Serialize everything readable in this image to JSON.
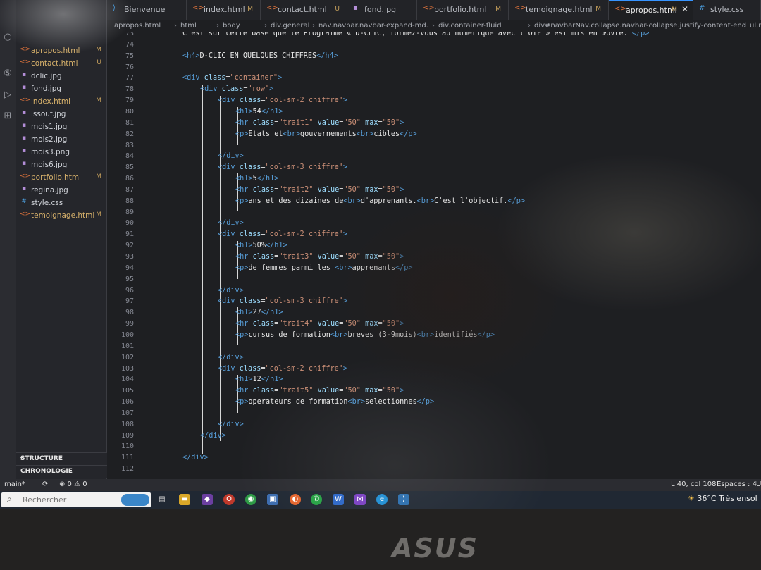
{
  "tabs": [
    {
      "label": "Bienvenue",
      "icon": "vscode-icon",
      "mod": ""
    },
    {
      "label": "index.html",
      "icon": "html-icon",
      "mod": "M"
    },
    {
      "label": "contact.html",
      "icon": "html-icon",
      "mod": "U"
    },
    {
      "label": "fond.jpg",
      "icon": "image-icon",
      "mod": ""
    },
    {
      "label": "portfolio.html",
      "icon": "html-icon",
      "mod": "M"
    },
    {
      "label": "temoignage.html",
      "icon": "html-icon",
      "mod": "M"
    },
    {
      "label": "apropos.html",
      "icon": "html-icon",
      "mod": "M"
    },
    {
      "label": "style.css",
      "icon": "css-icon",
      "mod": ""
    }
  ],
  "breadcrumbs": [
    "apropos.html",
    "html",
    "body",
    "div.general",
    "nav.navbar.navbar-expand-md.",
    "div.container-fluid",
    "div#navbarNav.collapse.navbar-collapse.justify-content-end",
    "ul.n"
  ],
  "explorer": {
    "files": [
      {
        "name": "apropos.html",
        "type": "html",
        "mod": "M"
      },
      {
        "name": "contact.html",
        "type": "html",
        "mod": "U"
      },
      {
        "name": "dclic.jpg",
        "type": "img",
        "mod": ""
      },
      {
        "name": "fond.jpg",
        "type": "img",
        "mod": ""
      },
      {
        "name": "index.html",
        "type": "html",
        "mod": "M"
      },
      {
        "name": "issouf.jpg",
        "type": "img",
        "mod": ""
      },
      {
        "name": "mois1.jpg",
        "type": "img",
        "mod": ""
      },
      {
        "name": "mois2.jpg",
        "type": "img",
        "mod": ""
      },
      {
        "name": "mois3.png",
        "type": "img",
        "mod": ""
      },
      {
        "name": "mois6.jpg",
        "type": "img",
        "mod": ""
      },
      {
        "name": "portfolio.html",
        "type": "html",
        "mod": "M"
      },
      {
        "name": "regina.jpg",
        "type": "img",
        "mod": ""
      },
      {
        "name": "style.css",
        "type": "css",
        "mod": ""
      },
      {
        "name": "temoignage.html",
        "type": "html",
        "mod": "M"
      }
    ],
    "sections": [
      "STRUCTURE",
      "CHRONOLOGIE"
    ]
  },
  "code_lines": [
    {
      "n": "73",
      "indent": 0,
      "parts": [
        [
          "txt",
          "C'est sur cette base que le Programme « D-CLIC, formez-vous au numérique avec l'OIF » est mis en œuvre. "
        ],
        [
          "tag",
          "</p>"
        ]
      ]
    },
    {
      "n": "74",
      "indent": 0,
      "parts": []
    },
    {
      "n": "75",
      "indent": 0,
      "parts": [
        [
          "tag",
          "<h4>"
        ],
        [
          "txt",
          "D-CLIC EN QUELQUES CHIFFRES"
        ],
        [
          "tag",
          "</h4>"
        ]
      ]
    },
    {
      "n": "76",
      "indent": 0,
      "parts": []
    },
    {
      "n": "77",
      "indent": 0,
      "parts": [
        [
          "tag",
          "<div "
        ],
        [
          "attr",
          "class"
        ],
        [
          "txt",
          "="
        ],
        [
          "str",
          "\"container\""
        ],
        [
          "tag",
          ">"
        ]
      ]
    },
    {
      "n": "78",
      "indent": 1,
      "parts": [
        [
          "tag",
          "<div "
        ],
        [
          "attr",
          "class"
        ],
        [
          "txt",
          "="
        ],
        [
          "str",
          "\"row\""
        ],
        [
          "tag",
          ">"
        ]
      ]
    },
    {
      "n": "79",
      "indent": 2,
      "parts": [
        [
          "tag",
          "<div "
        ],
        [
          "attr",
          "class"
        ],
        [
          "txt",
          "="
        ],
        [
          "str",
          "\"col-sm-2 chiffre\""
        ],
        [
          "tag",
          ">"
        ]
      ]
    },
    {
      "n": "80",
      "indent": 3,
      "parts": [
        [
          "tag",
          "<h1>"
        ],
        [
          "txt",
          "54"
        ],
        [
          "tag",
          "</h1>"
        ]
      ]
    },
    {
      "n": "81",
      "indent": 3,
      "parts": [
        [
          "tag",
          "<hr "
        ],
        [
          "attr",
          "class"
        ],
        [
          "txt",
          "="
        ],
        [
          "str",
          "\"trait1\""
        ],
        [
          "attr",
          " value"
        ],
        [
          "txt",
          "="
        ],
        [
          "str",
          "\"50\""
        ],
        [
          "attr",
          " max"
        ],
        [
          "txt",
          "="
        ],
        [
          "str",
          "\"50\""
        ],
        [
          "tag",
          ">"
        ]
      ]
    },
    {
      "n": "82",
      "indent": 3,
      "parts": [
        [
          "tag",
          "<p>"
        ],
        [
          "txt",
          "Etats et"
        ],
        [
          "tag",
          "<br>"
        ],
        [
          "txt",
          "gouvernements"
        ],
        [
          "tag",
          "<br>"
        ],
        [
          "txt",
          "cibles"
        ],
        [
          "tag",
          "</p>"
        ]
      ]
    },
    {
      "n": "83",
      "indent": 0,
      "parts": []
    },
    {
      "n": "84",
      "indent": 2,
      "parts": [
        [
          "tag",
          "</div>"
        ]
      ]
    },
    {
      "n": "85",
      "indent": 2,
      "parts": [
        [
          "tag",
          "<div "
        ],
        [
          "attr",
          "class"
        ],
        [
          "txt",
          "="
        ],
        [
          "str",
          "\"col-sm-3 chiffre\""
        ],
        [
          "tag",
          ">"
        ]
      ]
    },
    {
      "n": "86",
      "indent": 3,
      "parts": [
        [
          "tag",
          "<h1>"
        ],
        [
          "txt",
          "5"
        ],
        [
          "tag",
          "</h1>"
        ]
      ]
    },
    {
      "n": "87",
      "indent": 3,
      "parts": [
        [
          "tag",
          "<hr "
        ],
        [
          "attr",
          "class"
        ],
        [
          "txt",
          "="
        ],
        [
          "str",
          "\"trait2\""
        ],
        [
          "attr",
          " value"
        ],
        [
          "txt",
          "="
        ],
        [
          "str",
          "\"50\""
        ],
        [
          "attr",
          " max"
        ],
        [
          "txt",
          "="
        ],
        [
          "str",
          "\"50\""
        ],
        [
          "tag",
          ">"
        ]
      ]
    },
    {
      "n": "88",
      "indent": 3,
      "parts": [
        [
          "tag",
          "<p>"
        ],
        [
          "txt",
          "ans et des dizaines de"
        ],
        [
          "tag",
          "<br>"
        ],
        [
          "txt",
          "d'apprenants."
        ],
        [
          "tag",
          "<br>"
        ],
        [
          "txt",
          "C'est l'objectif."
        ],
        [
          "tag",
          "</p>"
        ]
      ]
    },
    {
      "n": "89",
      "indent": 0,
      "parts": []
    },
    {
      "n": "90",
      "indent": 2,
      "parts": [
        [
          "tag",
          "</div>"
        ]
      ]
    },
    {
      "n": "91",
      "indent": 2,
      "parts": [
        [
          "tag",
          "<div "
        ],
        [
          "attr",
          "class"
        ],
        [
          "txt",
          "="
        ],
        [
          "str",
          "\"col-sm-2 chiffre\""
        ],
        [
          "tag",
          ">"
        ]
      ]
    },
    {
      "n": "92",
      "indent": 3,
      "parts": [
        [
          "tag",
          "<h1>"
        ],
        [
          "txt",
          "50%"
        ],
        [
          "tag",
          "</h1>"
        ]
      ]
    },
    {
      "n": "93",
      "indent": 3,
      "parts": [
        [
          "tag",
          "<hr "
        ],
        [
          "attr",
          "class"
        ],
        [
          "txt",
          "="
        ],
        [
          "str",
          "\"trait3\""
        ],
        [
          "attr",
          " value"
        ],
        [
          "txt",
          "="
        ],
        [
          "str",
          "\"50\""
        ],
        [
          "attr",
          " max"
        ],
        [
          "txt",
          "="
        ],
        [
          "str",
          "\"50\""
        ],
        [
          "tag",
          ">"
        ]
      ]
    },
    {
      "n": "94",
      "indent": 3,
      "parts": [
        [
          "tag",
          "<p>"
        ],
        [
          "txt",
          "de femmes parmi les "
        ],
        [
          "tag",
          "<br>"
        ],
        [
          "txt",
          "apprenants"
        ],
        [
          "tag",
          "</p>"
        ]
      ]
    },
    {
      "n": "95",
      "indent": 0,
      "parts": []
    },
    {
      "n": "96",
      "indent": 2,
      "parts": [
        [
          "tag",
          "</div>"
        ]
      ]
    },
    {
      "n": "97",
      "indent": 2,
      "parts": [
        [
          "tag",
          "<div "
        ],
        [
          "attr",
          "class"
        ],
        [
          "txt",
          "="
        ],
        [
          "str",
          "\"col-sm-3 chiffre\""
        ],
        [
          "tag",
          ">"
        ]
      ]
    },
    {
      "n": "98",
      "indent": 3,
      "parts": [
        [
          "tag",
          "<h1>"
        ],
        [
          "txt",
          "27"
        ],
        [
          "tag",
          "</h1>"
        ]
      ]
    },
    {
      "n": "99",
      "indent": 3,
      "parts": [
        [
          "tag",
          "<hr "
        ],
        [
          "attr",
          "class"
        ],
        [
          "txt",
          "="
        ],
        [
          "str",
          "\"trait4\""
        ],
        [
          "attr",
          " value"
        ],
        [
          "txt",
          "="
        ],
        [
          "str",
          "\"50\""
        ],
        [
          "attr",
          " max"
        ],
        [
          "txt",
          "="
        ],
        [
          "str",
          "\"50\""
        ],
        [
          "tag",
          ">"
        ]
      ]
    },
    {
      "n": "100",
      "indent": 3,
      "parts": [
        [
          "tag",
          "<p>"
        ],
        [
          "txt",
          "cursus de formation"
        ],
        [
          "tag",
          "<br>"
        ],
        [
          "txt",
          "breves (3-9mois)"
        ],
        [
          "tag",
          "<br>"
        ],
        [
          "txt",
          "identifiés"
        ],
        [
          "tag",
          "</p>"
        ]
      ]
    },
    {
      "n": "101",
      "indent": 0,
      "parts": []
    },
    {
      "n": "102",
      "indent": 2,
      "parts": [
        [
          "tag",
          "</div>"
        ]
      ]
    },
    {
      "n": "103",
      "indent": 2,
      "parts": [
        [
          "tag",
          "<div "
        ],
        [
          "attr",
          "class"
        ],
        [
          "txt",
          "="
        ],
        [
          "str",
          "\"col-sm-2 chiffre\""
        ],
        [
          "tag",
          ">"
        ]
      ]
    },
    {
      "n": "104",
      "indent": 3,
      "parts": [
        [
          "tag",
          "<h1>"
        ],
        [
          "txt",
          "12"
        ],
        [
          "tag",
          "</h1>"
        ]
      ]
    },
    {
      "n": "105",
      "indent": 3,
      "parts": [
        [
          "tag",
          "<hr "
        ],
        [
          "attr",
          "class"
        ],
        [
          "txt",
          "="
        ],
        [
          "str",
          "\"trait5\""
        ],
        [
          "attr",
          " value"
        ],
        [
          "txt",
          "="
        ],
        [
          "str",
          "\"50\""
        ],
        [
          "attr",
          " max"
        ],
        [
          "txt",
          "="
        ],
        [
          "str",
          "\"50\""
        ],
        [
          "tag",
          ">"
        ]
      ]
    },
    {
      "n": "106",
      "indent": 3,
      "parts": [
        [
          "tag",
          "<p>"
        ],
        [
          "txt",
          "operateurs de formation"
        ],
        [
          "tag",
          "<br>"
        ],
        [
          "txt",
          "selectionnes"
        ],
        [
          "tag",
          "</p>"
        ]
      ]
    },
    {
      "n": "107",
      "indent": 0,
      "parts": []
    },
    {
      "n": "108",
      "indent": 2,
      "parts": [
        [
          "tag",
          "</div>"
        ]
      ]
    },
    {
      "n": "109",
      "indent": 1,
      "parts": [
        [
          "tag",
          "</div>"
        ]
      ]
    },
    {
      "n": "110",
      "indent": 0,
      "parts": []
    },
    {
      "n": "111",
      "indent": 0,
      "parts": [
        [
          "tag",
          "</div>"
        ]
      ]
    },
    {
      "n": "112",
      "indent": 0,
      "parts": []
    }
  ],
  "status": {
    "branch": "main*",
    "sync": "⟳",
    "problems": "⊗ 0 ⚠ 0",
    "position": "L 40, col 108",
    "spaces": "Espaces : 4",
    "encoding": "U"
  },
  "taskbar": {
    "search_placeholder": "Rechercher",
    "weather": "36°C  Très ensol"
  },
  "laptop_brand": "ASUS"
}
